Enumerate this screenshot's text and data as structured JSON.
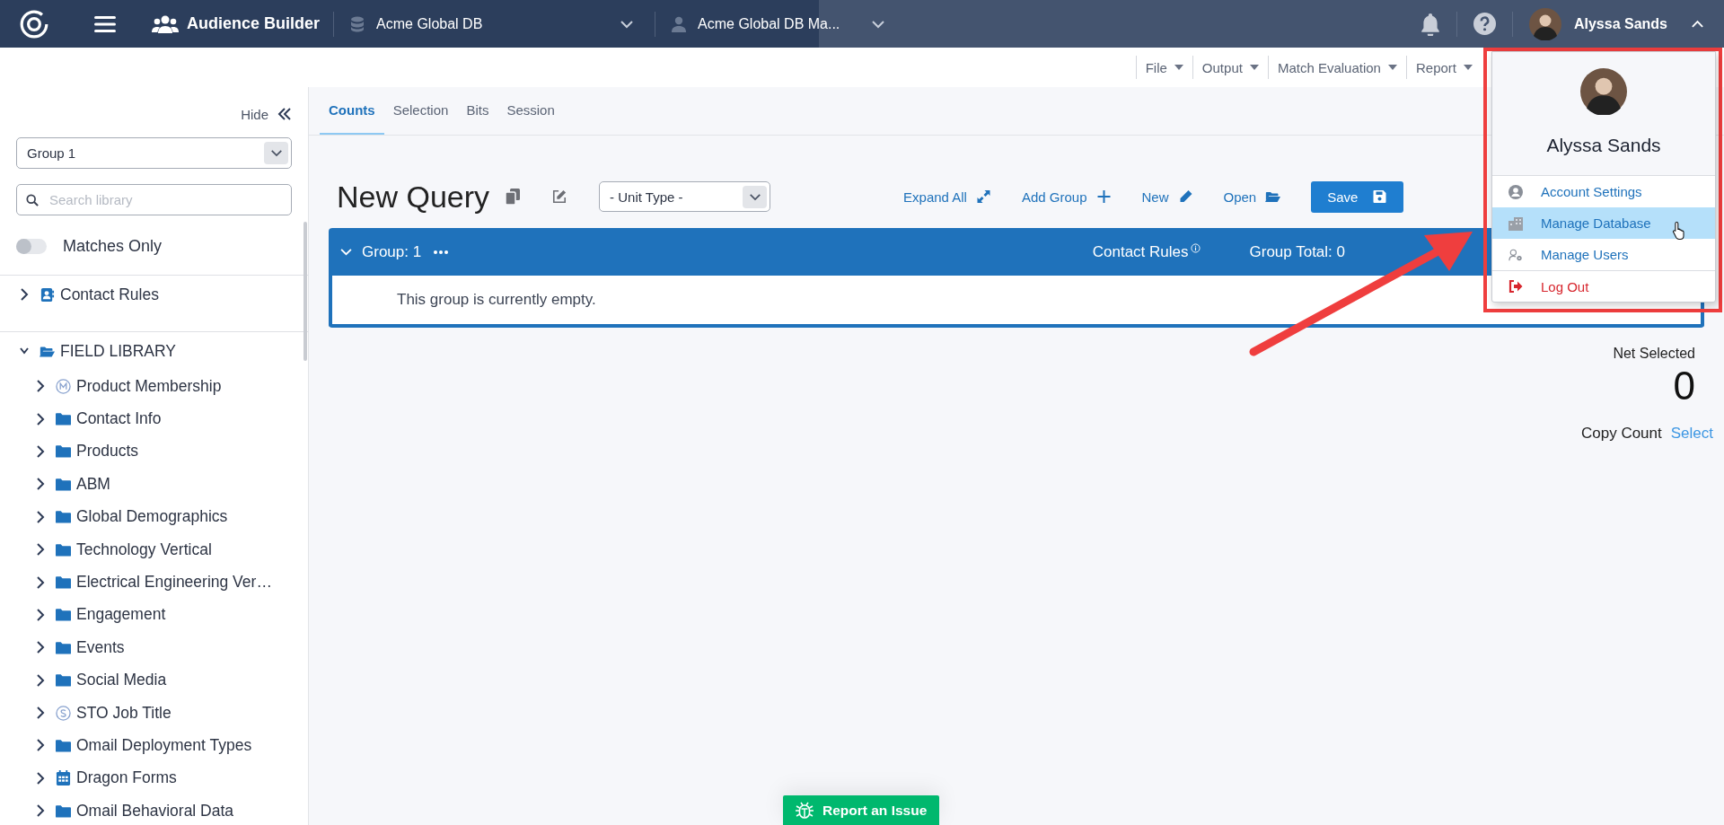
{
  "topbar": {
    "app_title": "Audience Builder",
    "database": "Acme Global DB",
    "account": "Acme Global DB Ma...",
    "user_name": "Alyssa Sands",
    "user_menu_expanded": true
  },
  "menubar": [
    "File",
    "Output",
    "Match Evaluation",
    "Report"
  ],
  "sidebar": {
    "hide_label": "Hide",
    "group_select": "Group 1",
    "search": {
      "placeholder": "Search library"
    },
    "matches_only": {
      "label": "Matches Only",
      "on": false
    },
    "tree": [
      {
        "label": "Contact Rules",
        "kind": "contact",
        "expanded": false
      },
      {
        "label": "FIELD LIBRARY",
        "kind": "library",
        "expanded": true,
        "children": [
          {
            "label": "Product Membership",
            "kind": "membership",
            "expanded": false
          },
          {
            "label": "Contact Info",
            "kind": "folder",
            "expanded": false
          },
          {
            "label": "Products",
            "kind": "folder",
            "expanded": false
          },
          {
            "label": "ABM",
            "kind": "folder",
            "expanded": false
          },
          {
            "label": "Global Demographics",
            "kind": "folder",
            "expanded": false
          },
          {
            "label": "Technology Vertical",
            "kind": "folder",
            "expanded": false
          },
          {
            "label": "Electrical Engineering Ver…",
            "kind": "folder",
            "expanded": false
          },
          {
            "label": "Engagement",
            "kind": "folder",
            "expanded": false
          },
          {
            "label": "Events",
            "kind": "folder",
            "expanded": false
          },
          {
            "label": "Social Media",
            "kind": "folder",
            "expanded": false
          },
          {
            "label": "STO Job Title",
            "kind": "sto",
            "expanded": false
          },
          {
            "label": "Omail Deployment Types",
            "kind": "folder",
            "expanded": false
          },
          {
            "label": "Dragon Forms",
            "kind": "forms",
            "expanded": false
          },
          {
            "label": "Omail Behavioral Data",
            "kind": "folder",
            "expanded": false
          }
        ]
      }
    ]
  },
  "tabs": [
    {
      "label": "Counts",
      "selected": true
    },
    {
      "label": "Selection",
      "selected": false
    },
    {
      "label": "Bits",
      "selected": false
    },
    {
      "label": "Session",
      "selected": false
    }
  ],
  "query": {
    "title": "New Query",
    "unit_type": "- Unit Type -",
    "actions": [
      {
        "label": "Expand All",
        "kind": "expand"
      },
      {
        "label": "Add Group",
        "kind": "add"
      },
      {
        "label": "New",
        "kind": "new"
      },
      {
        "label": "Open",
        "kind": "open"
      },
      {
        "label": "Save",
        "kind": "save"
      }
    ],
    "group": {
      "title": "Group: 1",
      "contact_rules": "Contact Rules",
      "total": "Group Total: 0",
      "empty_message": "This group is currently empty."
    },
    "net_selected_label": "Net Selected",
    "net_selected": "0",
    "copy_count_label": "Copy Count",
    "copy_count_link": "Select"
  },
  "user_menu": {
    "name": "Alyssa Sands",
    "items": [
      {
        "label": "Account Settings",
        "kind": "account",
        "highlighted": false
      },
      {
        "label": "Manage Database",
        "kind": "database",
        "highlighted": true
      },
      {
        "label": "Manage Users",
        "kind": "users",
        "highlighted": false
      },
      {
        "label": "Log Out",
        "kind": "logout",
        "highlighted": false
      }
    ]
  },
  "report_button": "Report an Issue"
}
